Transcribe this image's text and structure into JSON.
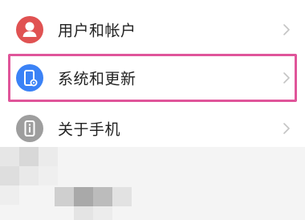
{
  "settings": {
    "items": [
      {
        "label": "用户和帐户",
        "icon": "person-icon",
        "icon_color": "#e05252",
        "highlighted": false
      },
      {
        "label": "系统和更新",
        "icon": "phone-settings-icon",
        "icon_color": "#3b82f6",
        "highlighted": true
      },
      {
        "label": "关于手机",
        "icon": "info-icon",
        "icon_color": "#9e9e9e",
        "highlighted": false
      }
    ]
  },
  "colors": {
    "highlight_border": "#e0559a",
    "chevron": "#c4c4c4"
  }
}
